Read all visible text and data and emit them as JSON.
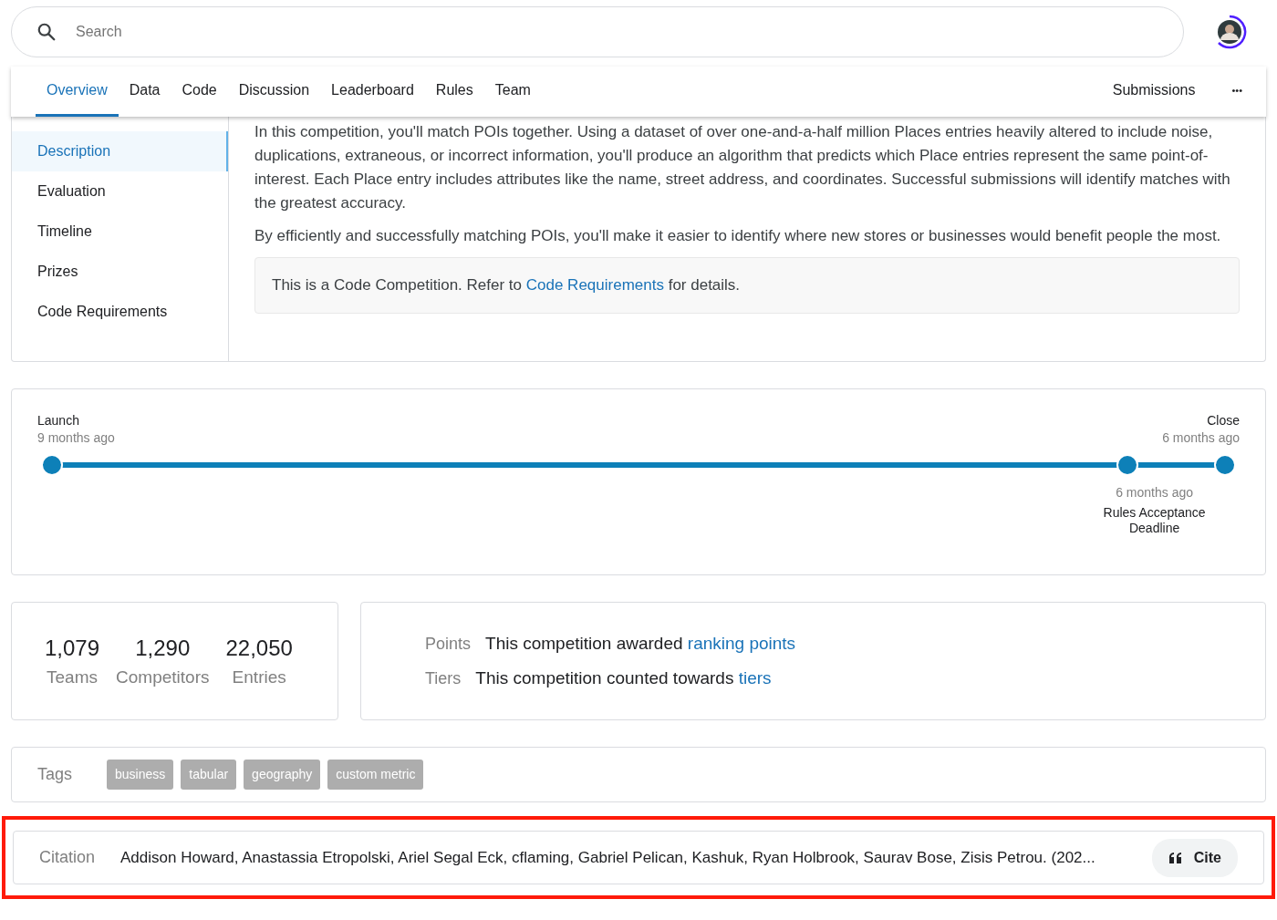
{
  "search": {
    "placeholder": "Search"
  },
  "tabs": [
    {
      "label": "Overview",
      "selected": true
    },
    {
      "label": "Data",
      "selected": false
    },
    {
      "label": "Code",
      "selected": false
    },
    {
      "label": "Discussion",
      "selected": false
    },
    {
      "label": "Leaderboard",
      "selected": false
    },
    {
      "label": "Rules",
      "selected": false
    },
    {
      "label": "Team",
      "selected": false
    }
  ],
  "submissions_tab": {
    "label": "Submissions",
    "selected": false
  },
  "more_button": {
    "label": "•••"
  },
  "sidebar": {
    "items": [
      {
        "label": "Description",
        "selected": true
      },
      {
        "label": "Evaluation",
        "selected": false
      },
      {
        "label": "Timeline",
        "selected": false
      },
      {
        "label": "Prizes",
        "selected": false
      },
      {
        "label": "Code Requirements",
        "selected": false
      }
    ]
  },
  "description": {
    "paragraphs": [
      "In this competition, you'll match POIs together. Using a dataset of over one-and-a-half million Places entries heavily altered to include noise, duplications, extraneous, or incorrect information, you'll produce an algorithm that predicts which Place entries represent the same point-of-interest. Each Place entry includes attributes like the name, street address, and coordinates. Successful submissions will identify matches with the greatest accuracy.",
      "By efficiently and successfully matching POIs, you'll make it easier to identify where new stores or businesses would benefit people the most."
    ],
    "note": {
      "before": "This is a Code Competition. Refer to",
      "link": "Code Requirements",
      "after": "for details."
    }
  },
  "timeline": {
    "milestones": [
      {
        "kind": "start",
        "title": "Launch",
        "time": "9 months ago",
        "level": 0
      },
      {
        "kind": "middle",
        "title": "Rules Acceptance Deadline",
        "time": "6 months ago",
        "level": 0.917
      },
      {
        "kind": "end",
        "title": "Close",
        "time": "6 months ago",
        "level": 1
      }
    ]
  },
  "stats": [
    {
      "value": "1,079",
      "label": "Teams"
    },
    {
      "value": "1,290",
      "label": "Competitors"
    },
    {
      "value": "22,050",
      "label": "Entries"
    }
  ],
  "awards": [
    {
      "label": "Points",
      "text": "This competition awarded",
      "link": "ranking points"
    },
    {
      "label": "Tiers",
      "text": "This competition counted towards",
      "link": "tiers"
    }
  ],
  "tags": {
    "label": "Tags",
    "items": [
      "business",
      "tabular",
      "geography",
      "custom metric"
    ]
  },
  "citation": {
    "label": "Citation",
    "text": "Addison Howard, Anastassia Etropolski, Ariel Segal Eck, cflaming, Gabriel Pelican, Kashuk, Ryan Holbrook, Saurav Bose, Zisis Petrou. (202...",
    "button": "Cite",
    "highlighted": true
  }
}
